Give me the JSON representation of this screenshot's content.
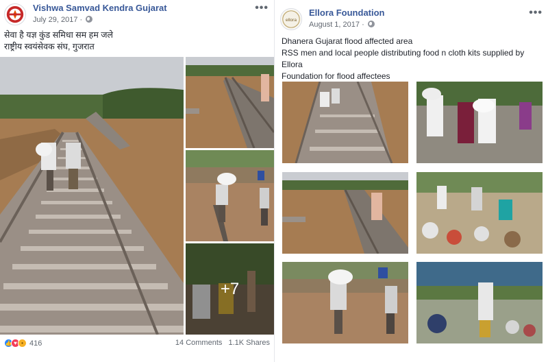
{
  "left_post": {
    "page_name": "Vishwa Samvad Kendra Gujarat",
    "date": "July 29, 2017",
    "more_label": "•••",
    "text_lines": [
      "सेवा है यज्ञ कुंड समिधा सम हम जले",
      "राष्ट्रीय स्वयंसेवक संघ, गुजरात"
    ],
    "more_photos_label": "+7",
    "reaction_count": "416",
    "comments_label": "14 Comments",
    "shares_label": "1.1K Shares",
    "avatar_icon": "vsk-logo-icon"
  },
  "right_post": {
    "page_name": "Ellora Foundation",
    "date": "August 1, 2017",
    "more_label": "•••",
    "text_lines": [
      "Dhanera Gujarat flood affected area",
      "RSS men and local people distributing food n cloth kits supplied by Ellora",
      "Foundation for flood affectees"
    ],
    "avatar_label": "ellora",
    "avatar_icon": "ellora-logo-icon"
  },
  "colors": {
    "link": "#385898",
    "meta": "#616770",
    "flood_water": "#a67c52",
    "sky": "#c9ccd1",
    "foliage": "#4f6b3a",
    "rail": "#6b6159",
    "like": "#2d88ff",
    "love": "#f33e58"
  }
}
